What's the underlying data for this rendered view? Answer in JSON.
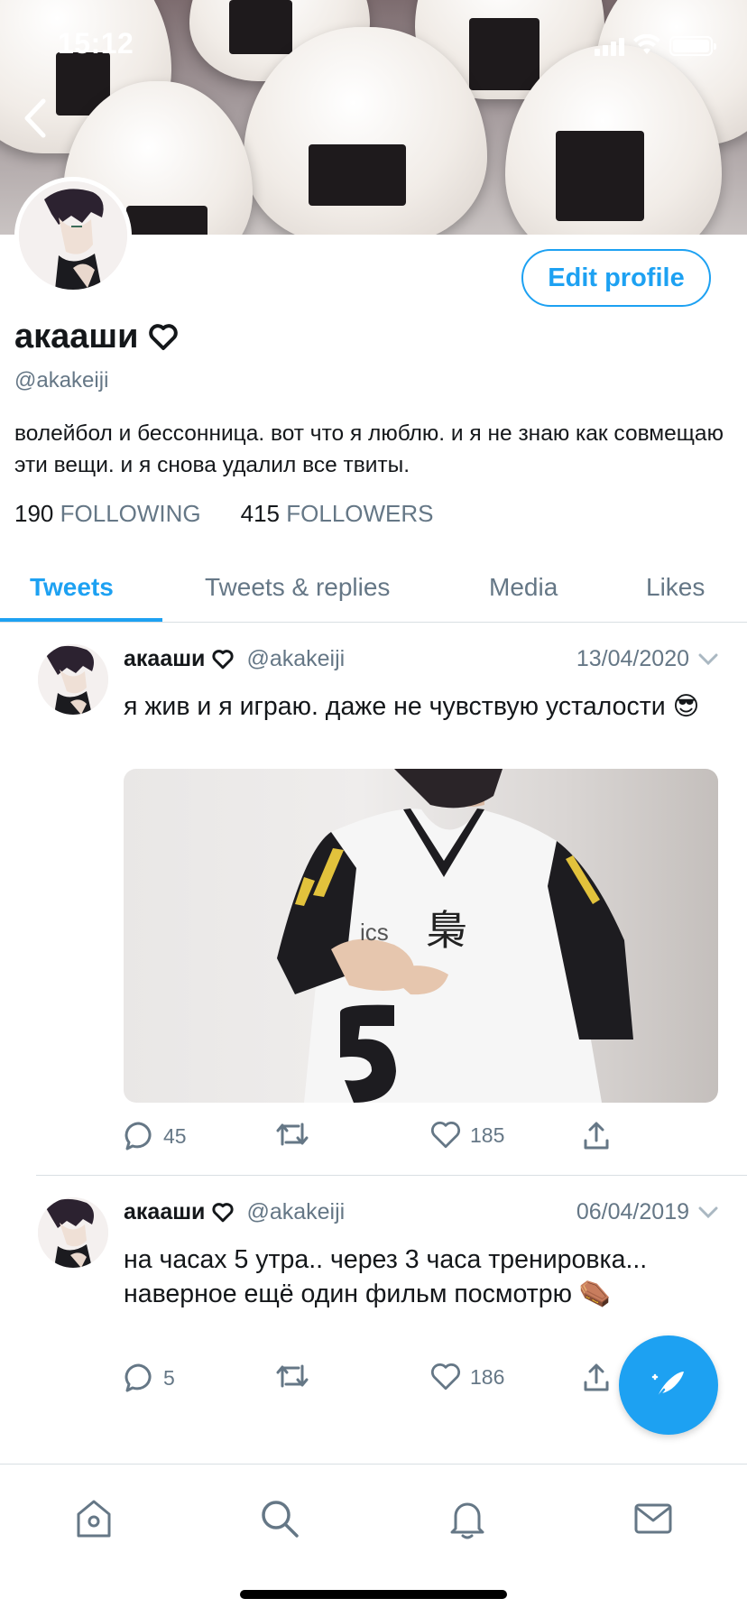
{
  "status_bar": {
    "time": "15:12"
  },
  "profile": {
    "display_name": "акааши",
    "handle": "@akakeiji",
    "bio": "волейбол и бессонница. вот что я люблю. и я не знаю как совмещаю эти вещи. и я снова удалил все твиты.",
    "following_count": "190",
    "following_label": "FOLLOWING",
    "followers_count": "415",
    "followers_label": "FOLLOWERS",
    "edit_button_label": "Edit profile"
  },
  "tabs": [
    {
      "label": "Tweets",
      "active": true
    },
    {
      "label": "Tweets & replies",
      "active": false
    },
    {
      "label": "Media",
      "active": false
    },
    {
      "label": "Likes",
      "active": false
    }
  ],
  "tweets": [
    {
      "name": "акааши",
      "handle": "@akakeiji",
      "date": "13/04/2020",
      "text": "я жив и я играю. даже не чувствую усталости 😎",
      "has_media": true,
      "media_text": "ics",
      "media_kanji": "梟",
      "media_number": "5",
      "replies": "45",
      "retweets": "",
      "likes": "185"
    },
    {
      "name": "акааши",
      "handle": "@akakeiji",
      "date": "06/04/2019",
      "text": "на часах 5 утра.. через 3 часа тренировка... наверное ещё один фильм посмотрю ⚰️",
      "has_media": false,
      "replies": "5",
      "retweets": "",
      "likes": "186"
    }
  ],
  "icons": {
    "back": "chevron-left-icon",
    "heart_outline": "heart-icon",
    "reply": "reply-icon",
    "retweet": "retweet-icon",
    "like": "heart-icon",
    "share": "share-icon",
    "compose": "compose-tweet-icon",
    "nav": [
      "home-icon",
      "search-icon",
      "bell-icon",
      "mail-icon"
    ]
  },
  "colors": {
    "accent": "#1da1f2",
    "secondary_text": "#657786",
    "divider": "#d9dfe3"
  }
}
